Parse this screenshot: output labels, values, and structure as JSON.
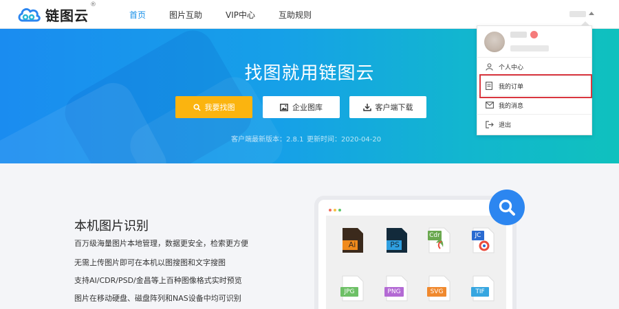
{
  "brand": {
    "name": "链图云",
    "reg": "®",
    "logo_icon": "cloud-logo-icon"
  },
  "nav": {
    "items": [
      {
        "label": "首页",
        "active": true
      },
      {
        "label": "图片互助"
      },
      {
        "label": "VIP中心"
      },
      {
        "label": "互助规则"
      }
    ]
  },
  "hero": {
    "title": "找图就用链图云",
    "buttons": {
      "find": "我要找图",
      "enterprise": "企业图库",
      "download": "客户端下载"
    },
    "version": "客户端最新版本：2.8.1",
    "updated": "更新时间：2020-04-20"
  },
  "feature": {
    "title": "本机图片识别",
    "lines": [
      "百万级海量图片本地管理，数据更安全，检索更方便",
      "无需上传图片即可在本机以图搜图和文字搜图",
      "支持AI/CDR/PSD/金昌等上百种图像格式实时预览",
      "图片在移动硬盘、磁盘阵列和NAS设备中均可识别"
    ]
  },
  "file_icons": [
    {
      "tag": "Ai",
      "color": "#f08a1c"
    },
    {
      "tag": "PS",
      "color": "#2f9fe0"
    },
    {
      "tag": "Cdr",
      "color": "#6aa84f"
    },
    {
      "tag": "JC",
      "color": "#2a6bd1"
    },
    {
      "tag": "JPG",
      "color": "#6dc066"
    },
    {
      "tag": "PNG",
      "color": "#b36ad4"
    },
    {
      "tag": "SVG",
      "color": "#f0892e"
    },
    {
      "tag": "TIF",
      "color": "#36a6e0"
    }
  ],
  "user_menu": {
    "items": [
      {
        "label": "个人中心",
        "icon": "user-icon"
      },
      {
        "label": "我的订单",
        "icon": "order-icon"
      },
      {
        "label": "我的消息",
        "icon": "mail-icon"
      },
      {
        "label": "退出",
        "icon": "logout-icon"
      }
    ],
    "highlight_color": "#d9363e"
  },
  "colors": {
    "accent": "#1890e8",
    "primary_button": "#fbb40f"
  }
}
